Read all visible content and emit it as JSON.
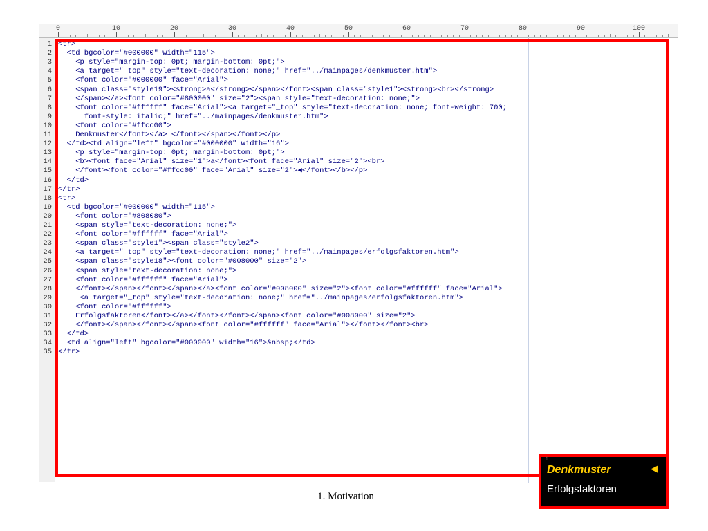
{
  "ruler": {
    "labels": [
      "0",
      "10",
      "20",
      "30",
      "40",
      "50",
      "60",
      "70",
      "80",
      "90",
      "100"
    ]
  },
  "editor": {
    "line_numbers": [
      "1",
      "2",
      "3",
      "4",
      "5",
      "6",
      "7",
      "8",
      "9",
      "10",
      "11",
      "12",
      "13",
      "14",
      "15",
      "16",
      "17",
      "18",
      "19",
      "20",
      "21",
      "22",
      "23",
      "24",
      "25",
      "26",
      "27",
      "28",
      "29",
      "30",
      "31",
      "32",
      "33",
      "34",
      "35"
    ],
    "lines": [
      "<tr>",
      "  <td bgcolor=\"#000000\" width=\"115\">",
      "    <p style=\"margin-top: 0pt; margin-bottom: 0pt;\">",
      "    <a target=\"_top\" style=\"text-decoration: none;\" href=\"../mainpages/denkmuster.htm\">",
      "    <font color=\"#000000\" face=\"Arial\">",
      "    <span class=\"style19\"><strong>a</strong></span></font><span class=\"style1\"><strong><br></strong>",
      "    </span></a><font color=\"#800000\" size=\"2\"><span style=\"text-decoration: none;\">",
      "    <font color=\"#ffffff\" face=\"Arial\"><a target=\"_top\" style=\"text-decoration: none; font-weight: 700;",
      "      font-style: italic;\" href=\"../mainpages/denkmuster.htm\">",
      "    <font color=\"#ffcc00\">",
      "    Denkmuster</font></a> </font></span></font></p>",
      "  </td><td align=\"left\" bgcolor=\"#000000\" width=\"16\">",
      "    <p style=\"margin-top: 0pt; margin-bottom: 0pt;\">",
      "    <b><font face=\"Arial\" size=\"1\">a</font><font face=\"Arial\" size=\"2\"><br>",
      "    </font><font color=\"#ffcc00\" face=\"Arial\" size=\"2\">◀</font></b></p>",
      "  </td>",
      "</tr>",
      "<tr>",
      "  <td bgcolor=\"#000000\" width=\"115\">",
      "    <font color=\"#808080\">",
      "    <span style=\"text-decoration: none;\">",
      "    <font color=\"#ffffff\" face=\"Arial\">",
      "    <span class=\"style1\"><span class=\"style2\">",
      "    <a target=\"_top\" style=\"text-decoration: none;\" href=\"../mainpages/erfolgsfaktoren.htm\">",
      "    <span class=\"style18\"><font color=\"#008000\" size=\"2\">",
      "    <span style=\"text-decoration: none;\">",
      "    <font color=\"#ffffff\" face=\"Arial\">",
      "    </font></span></font></span></a><font color=\"#008000\" size=\"2\"><font color=\"#ffffff\" face=\"Arial\">",
      "     <a target=\"_top\" style=\"text-decoration: none;\" href=\"../mainpages/erfolgsfaktoren.htm\">",
      "    <font color=\"#ffffff\">",
      "    Erfolgsfaktoren</font></a></font></font></span><font color=\"#008000\" size=\"2\">",
      "    </font></span></font></span><font color=\"#ffffff\" face=\"Arial\"></font></font><br>",
      "  </td>",
      "  <td align=\"left\" bgcolor=\"#000000\" width=\"16\">&nbsp;</td>",
      "</tr>"
    ]
  },
  "preview": {
    "corner_glyph": "tl",
    "item1": "Denkmuster",
    "arrow": "◀",
    "item2": "Erfolgsfaktoren"
  },
  "caption": "1. Motivation",
  "colors": {
    "highlight": "#ff0000",
    "code_text": "#000080",
    "preview_bg": "#000000",
    "item1_color": "#ffcc00",
    "item2_color": "#ffffff"
  }
}
